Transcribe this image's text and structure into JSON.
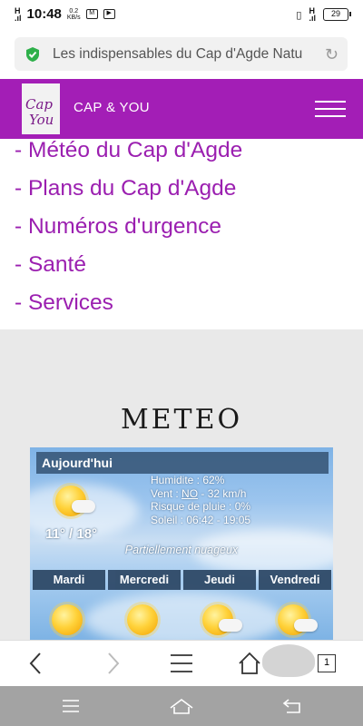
{
  "status_bar": {
    "time": "10:48",
    "speed_top": "0.2",
    "speed_bottom": "KB/s",
    "battery": "29"
  },
  "address_bar": {
    "url_text": "Les indispensables du Cap d'Agde Natu"
  },
  "site_header": {
    "logo_line1": "Cap",
    "logo_line2": "You",
    "brand": "CAP & YOU"
  },
  "links": [
    "- Météo du Cap d'Agde",
    "- Plans du Cap d'Agde",
    "- Numéros d'urgence",
    "- Santé",
    "- Services"
  ],
  "meteo": {
    "title": "METEO",
    "today_label": "Aujourd'hui",
    "humidity": "Humidite : 62%",
    "wind_prefix": "Vent : ",
    "wind_dir": "NO",
    "wind_suffix": " - 32 km/h",
    "rain": "Risque de pluie : 0%",
    "sun": "Soleil : 06:42 - 19:05",
    "temperature": "11° / 18°",
    "condition": "Partiellement nuageux",
    "days": [
      "Mardi",
      "Mercredi",
      "Jeudi",
      "Vendredi"
    ]
  },
  "toolbar": {
    "tab_count": "1"
  }
}
